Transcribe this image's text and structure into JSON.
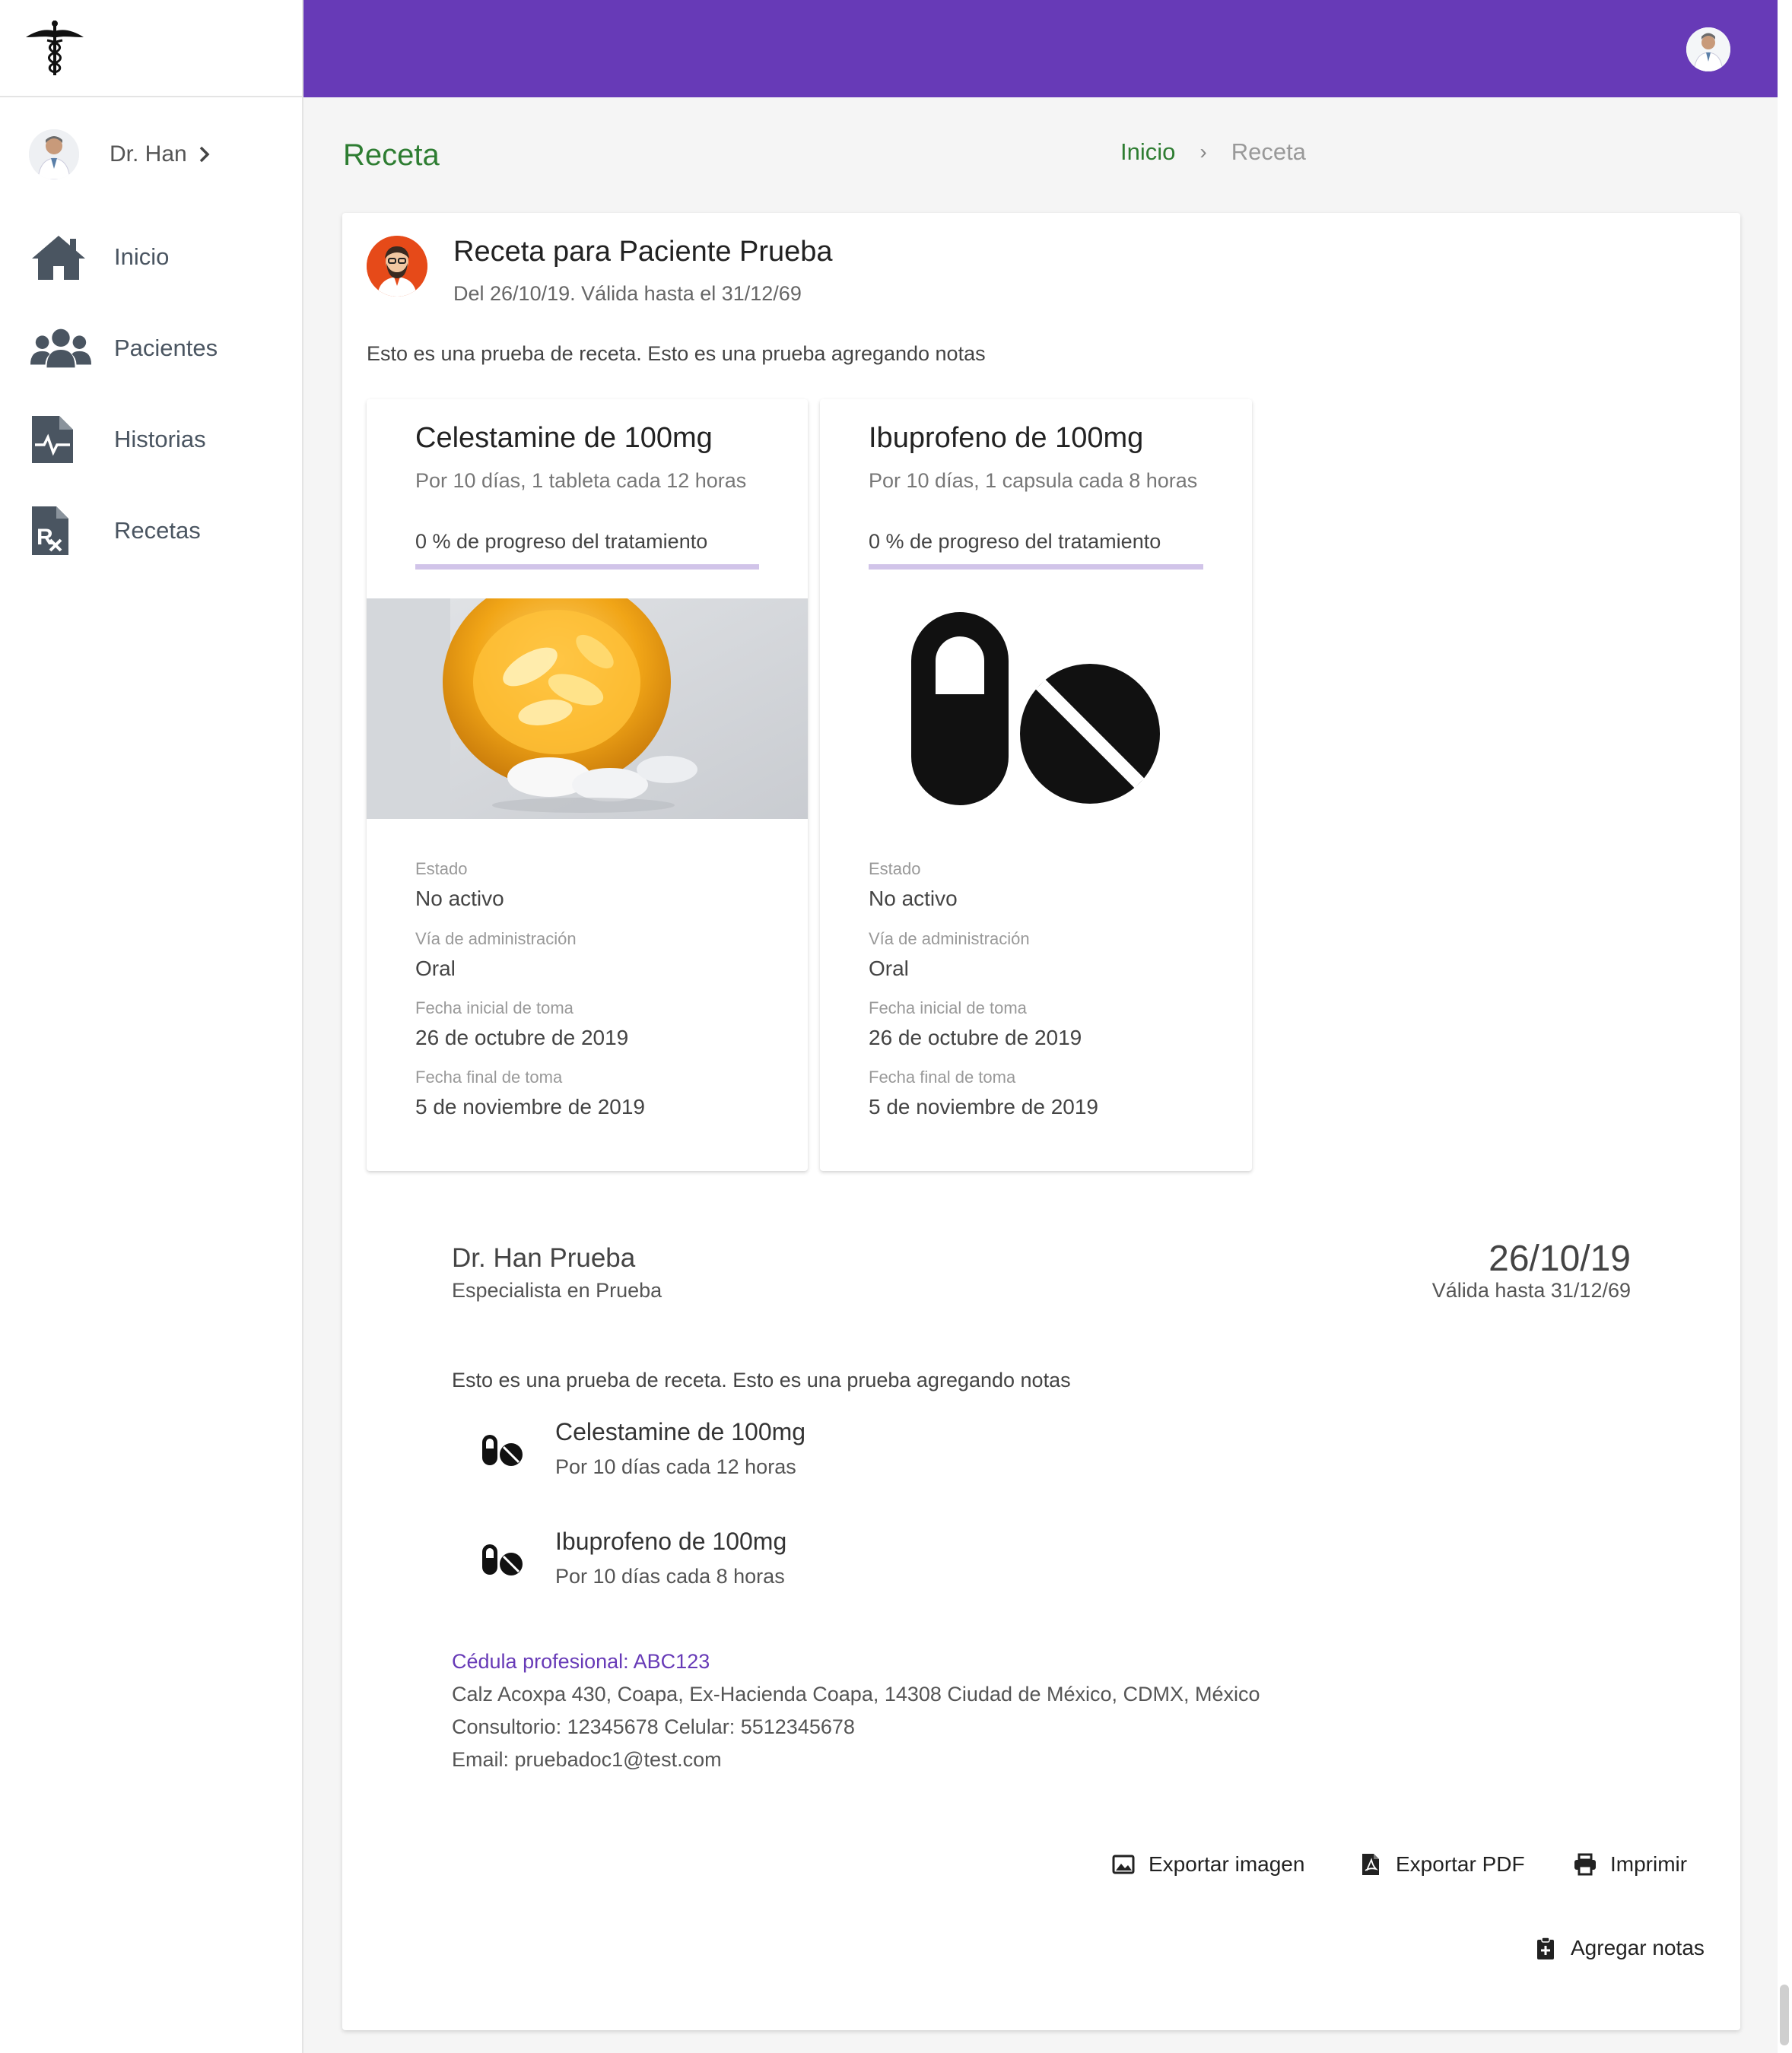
{
  "sidebar": {
    "user_name": "Dr. Han",
    "items": [
      {
        "label": "Inicio",
        "icon": "home-icon"
      },
      {
        "label": "Pacientes",
        "icon": "users-icon"
      },
      {
        "label": "Historias",
        "icon": "medical-file-icon"
      },
      {
        "label": "Recetas",
        "icon": "prescription-icon"
      }
    ]
  },
  "header": {
    "title": "Receta",
    "breadcrumb": {
      "home": "Inicio",
      "separator": "›",
      "current": "Receta"
    }
  },
  "prescription": {
    "title": "Receta para Paciente Prueba",
    "subtitle": "Del 26/10/19. Válida hasta el 31/12/69",
    "notes": "Esto es una prueba de receta. Esto es una prueba agregando notas",
    "medicines": [
      {
        "name": "Celestamine de 100mg",
        "dose": "Por 10 días, 1 tableta cada 12 horas",
        "progress_text": "0 % de progreso del tratamiento",
        "progress_fraction": 0,
        "image": "pill-bottle-photo",
        "estado_label": "Estado",
        "estado": "No activo",
        "via_label": "Vía de administración",
        "via": "Oral",
        "inicio_label": "Fecha inicial de toma",
        "inicio": "26 de octubre de 2019",
        "fin_label": "Fecha final de toma",
        "fin": "5 de noviembre de 2019"
      },
      {
        "name": "Ibuprofeno de 100mg",
        "dose": "Por 10 días, 1 capsula cada 8 horas",
        "progress_text": "0 % de progreso del tratamiento",
        "progress_fraction": 0,
        "image": "pills-icon",
        "estado_label": "Estado",
        "estado": "No activo",
        "via_label": "Vía de administración",
        "via": "Oral",
        "inicio_label": "Fecha inicial de toma",
        "inicio": "26 de octubre de 2019",
        "fin_label": "Fecha final de toma",
        "fin": "5 de noviembre de 2019"
      }
    ]
  },
  "printout": {
    "doctor": "Dr. Han Prueba",
    "specialty": "Especialista en Prueba",
    "date": "26/10/19",
    "valid": "Válida hasta 31/12/69",
    "notes": "Esto es una prueba de receta. Esto es una prueba agregando notas",
    "items": [
      {
        "name": "Celestamine de 100mg",
        "dose": "Por 10 días cada 12 horas"
      },
      {
        "name": "Ibuprofeno de 100mg",
        "dose": "Por 10 días cada 8 horas"
      }
    ],
    "cedula": "Cédula profesional: ABC123",
    "address": "Calz Acoxpa 430, Coapa, Ex-Hacienda Coapa, 14308 Ciudad de México, CDMX, México",
    "phones": "Consultorio: 12345678 Celular: 5512345678",
    "email": "Email: pruebadoc1@test.com"
  },
  "actions": {
    "export_image": "Exportar imagen",
    "export_pdf": "Exportar PDF",
    "print": "Imprimir",
    "add_notes": "Agregar notas"
  },
  "colors": {
    "primary": "#673ab7",
    "title_green": "#2e7d32",
    "progress_track": "#d1c4e9",
    "sidebar_icon": "#4a5561"
  }
}
